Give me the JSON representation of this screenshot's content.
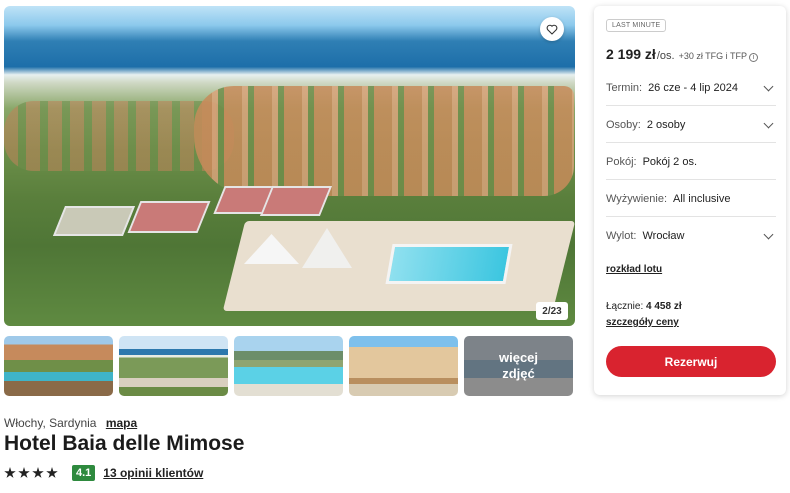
{
  "gallery": {
    "counter": "2/23",
    "more_label": "więcej zdjęć",
    "favorite_icon": "heart-icon",
    "thumbnails": [
      "resort-aerial",
      "coast-view",
      "pool",
      "building-terrace",
      "room"
    ]
  },
  "hotel": {
    "location": "Włochy, Sardynia",
    "map_link": "mapa",
    "name": "Hotel Baia delle Mimose",
    "stars": 4,
    "score": "4.1",
    "reviews_link": "13 opinii klientów"
  },
  "booking": {
    "badge": "LAST MINUTE",
    "price": "2 199 zł",
    "per_person": "/os.",
    "extra": "+30 zł TFG i TFP",
    "rows": [
      {
        "label": "Termin:",
        "value": "26 cze - 4 lip 2024"
      },
      {
        "label": "Osoby:",
        "value": "2 osoby"
      },
      {
        "label": "Pokój:",
        "value": "Pokój 2 os."
      },
      {
        "label": "Wyżywienie:",
        "value": "All inclusive"
      },
      {
        "label": "Wylot:",
        "value": "Wrocław"
      }
    ],
    "flight_link": "rozkład lotu",
    "total_label": "Łącznie:",
    "total_value": "4 458 zł",
    "details_link": "szczegóły ceny",
    "book_button": "Rezerwuj"
  },
  "colors": {
    "accent_red": "#d9232f",
    "score_green": "#2e8a3e"
  }
}
